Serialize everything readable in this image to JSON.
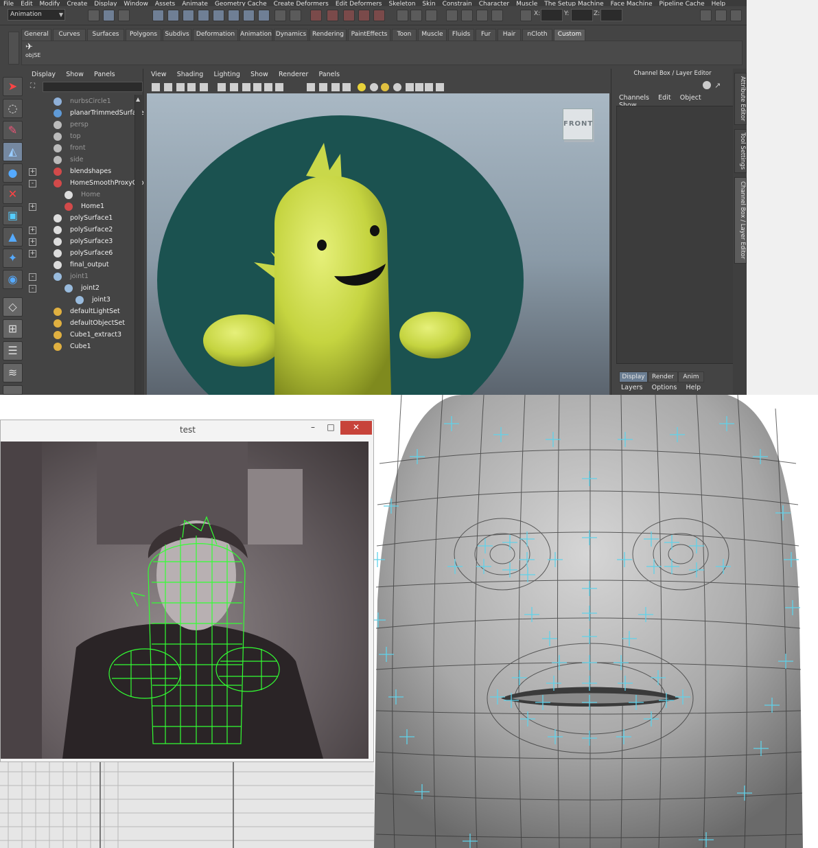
{
  "menubar": [
    "File",
    "Edit",
    "Modify",
    "Create",
    "Display",
    "Window",
    "Assets",
    "Animate",
    "Geometry Cache",
    "Create Deformers",
    "Edit Deformers",
    "Skeleton",
    "Skin",
    "Constrain",
    "Character",
    "Muscle",
    "The Setup Machine",
    "Face Machine",
    "Pipeline Cache",
    "Help"
  ],
  "status_line": {
    "mode": "Animation",
    "coord_labels": [
      "X:",
      "Y:",
      "Z:"
    ]
  },
  "shelf": {
    "tabs": [
      "General",
      "Curves",
      "Surfaces",
      "Polygons",
      "Subdivs",
      "Deformation",
      "Animation",
      "Dynamics",
      "Rendering",
      "PaintEffects",
      "Toon",
      "Muscle",
      "Fluids",
      "Fur",
      "Hair",
      "nCloth",
      "Custom"
    ],
    "active_tab": "Custom",
    "buttons": [
      {
        "label": "objSE",
        "icon": "run-icon"
      }
    ]
  },
  "outliner": {
    "menu": [
      "Display",
      "Show",
      "Panels"
    ],
    "items": [
      {
        "label": "nurbsCircle1",
        "dim": true,
        "icon": "curve-icon",
        "expand": ""
      },
      {
        "label": "planarTrimmedSurface",
        "dim": false,
        "icon": "surface-icon",
        "expand": ""
      },
      {
        "label": "persp",
        "dim": true,
        "icon": "camera-icon",
        "expand": ""
      },
      {
        "label": "top",
        "dim": true,
        "icon": "camera-icon",
        "expand": ""
      },
      {
        "label": "front",
        "dim": true,
        "icon": "camera-icon",
        "expand": ""
      },
      {
        "label": "side",
        "dim": true,
        "icon": "camera-icon",
        "expand": ""
      },
      {
        "label": "blendshapes",
        "dim": false,
        "icon": "mesh-icon",
        "expand": "+"
      },
      {
        "label": "HomeSmoothProxyGro",
        "dim": false,
        "icon": "mesh-icon",
        "expand": "-"
      },
      {
        "label": "Home",
        "dim": true,
        "icon": "group-icon",
        "expand": ""
      },
      {
        "label": "Home1",
        "dim": false,
        "icon": "mesh-icon",
        "expand": "+"
      },
      {
        "label": "polySurface1",
        "dim": false,
        "icon": "group-icon",
        "expand": ""
      },
      {
        "label": "polySurface2",
        "dim": false,
        "icon": "group-icon",
        "expand": "+"
      },
      {
        "label": "polySurface3",
        "dim": false,
        "icon": "group-icon",
        "expand": "+"
      },
      {
        "label": "polySurface6",
        "dim": false,
        "icon": "group-icon",
        "expand": "+"
      },
      {
        "label": "final_output",
        "dim": false,
        "icon": "group-icon",
        "expand": ""
      },
      {
        "label": "joint1",
        "dim": true,
        "icon": "joint-icon",
        "expand": "-"
      },
      {
        "label": "joint2",
        "dim": false,
        "icon": "joint-icon",
        "expand": "-"
      },
      {
        "label": "joint3",
        "dim": false,
        "icon": "joint-icon",
        "expand": ""
      },
      {
        "label": "defaultLightSet",
        "dim": false,
        "icon": "set-icon",
        "expand": ""
      },
      {
        "label": "defaultObjectSet",
        "dim": false,
        "icon": "set-icon",
        "expand": ""
      },
      {
        "label": "Cube1_extract3",
        "dim": false,
        "icon": "set-icon",
        "expand": ""
      },
      {
        "label": "Cube1",
        "dim": false,
        "icon": "set-icon",
        "expand": ""
      }
    ]
  },
  "viewport": {
    "menu": [
      "View",
      "Shading",
      "Lighting",
      "Show",
      "Renderer",
      "Panels"
    ],
    "view_cube_label": "FRONT"
  },
  "channel_box": {
    "title": "Channel Box / Layer Editor",
    "menu": [
      "Channels",
      "Edit",
      "Object",
      "Show"
    ],
    "tabs": [
      "Display",
      "Render",
      "Anim"
    ],
    "active_tab": "Display",
    "layer_menu": [
      "Layers",
      "Options",
      "Help"
    ],
    "side_tabs": [
      "Attribute Editor",
      "Tool Settings",
      "Channel Box / Layer Editor"
    ]
  },
  "test_window": {
    "title": "test",
    "minimize_glyph": "–",
    "maximize_glyph": "□",
    "close_glyph": "✕"
  },
  "colors": {
    "character_fill": "#c5d440",
    "backdrop_circle": "#1b5250",
    "wire_green": "#33ff33",
    "mesh_marker": "#5fd2ea"
  }
}
